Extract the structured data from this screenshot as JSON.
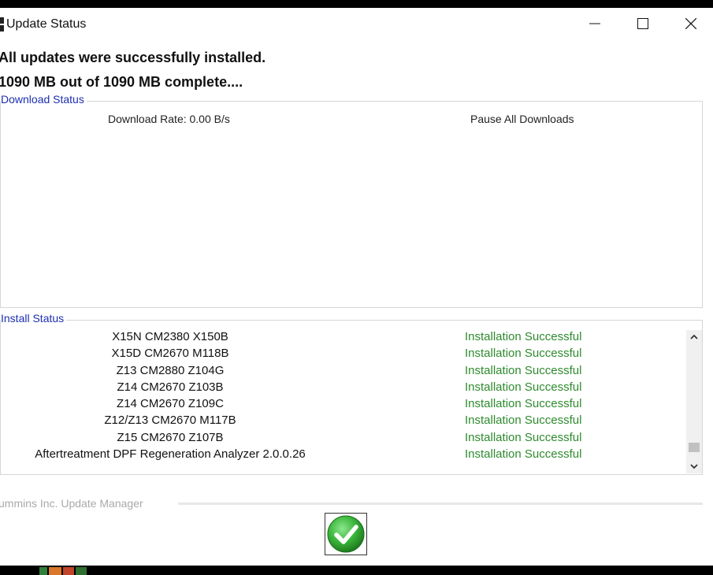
{
  "window": {
    "title": "Update Status",
    "icon": "app-icon",
    "controls": {
      "minimize": "minimize-icon",
      "maximize": "maximize-icon",
      "close": "close-icon"
    }
  },
  "status": {
    "message": "All updates were successfully installed.",
    "progress_text": "1090 MB out of 1090 MB complete...."
  },
  "download": {
    "label": "Download Status",
    "rate_text": "Download Rate: 0.00 B/s",
    "pause_text": "Pause All Downloads"
  },
  "install": {
    "label": "Install Status",
    "items": [
      {
        "name": "X15N CM2380 X150B",
        "status": "Installation Successful"
      },
      {
        "name": "X15D CM2670 M118B",
        "status": "Installation Successful"
      },
      {
        "name": "Z13 CM2880 Z104G",
        "status": "Installation Successful"
      },
      {
        "name": "Z14 CM2670 Z103B",
        "status": "Installation Successful"
      },
      {
        "name": "Z14 CM2670 Z109C",
        "status": "Installation Successful"
      },
      {
        "name": "Z12/Z13 CM2670 M117B",
        "status": "Installation Successful"
      },
      {
        "name": "Z15 CM2670 Z107B",
        "status": "Installation Successful"
      },
      {
        "name": "Aftertreatment DPF Regeneration Analyzer 2.0.0.26",
        "status": "Installation Successful"
      }
    ]
  },
  "footer": {
    "brand": "ummins Inc. Update Manager",
    "ok_icon": "checkmark-icon"
  },
  "colors": {
    "success_text": "#2e8b2e",
    "group_label": "#1c2fb0",
    "check_green": "#3cb83c"
  }
}
